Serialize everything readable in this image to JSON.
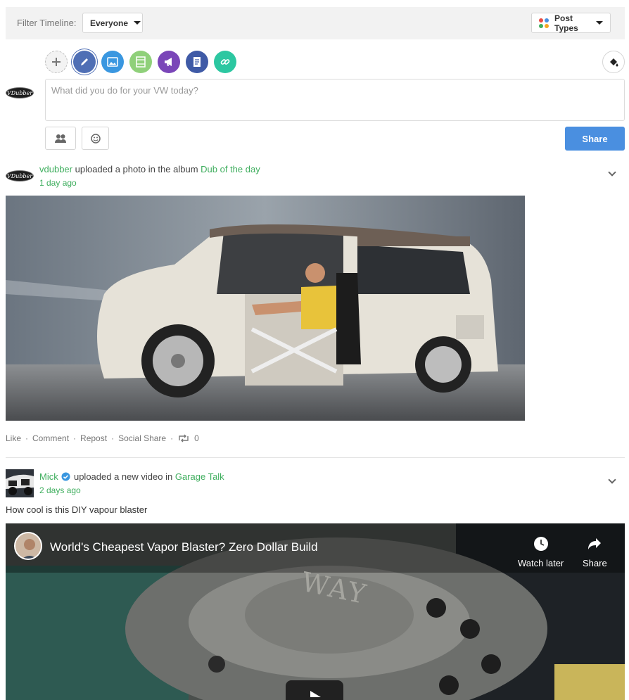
{
  "filter": {
    "label": "Filter Timeline:",
    "audience": "Everyone",
    "post_types_label": "Post Types",
    "dot_colors": [
      "#e84b43",
      "#4a8fe0",
      "#3fae5e",
      "#f5a623"
    ]
  },
  "composer": {
    "type_icons": [
      "plus-icon",
      "pencil-icon",
      "photo-icon",
      "film-icon",
      "megaphone-icon",
      "document-icon",
      "link-icon"
    ],
    "placeholder": "What did you do for your VW today?",
    "avatar_text": "VDubber",
    "share_label": "Share",
    "accent_color": "#4a8fe0"
  },
  "post1": {
    "author": "vdubber",
    "action": "uploaded a photo in the album",
    "album": "Dub of the day",
    "time": "1 day ago",
    "actions": {
      "like": "Like",
      "comment": "Comment",
      "repost": "Repost",
      "social_share": "Social Share",
      "repost_count": "0"
    }
  },
  "post2": {
    "author": "Mick",
    "action": "uploaded a new video in",
    "group": "Garage Talk",
    "time": "2 days ago",
    "caption": "How cool is this DIY vapour blaster",
    "video": {
      "title": "World's Cheapest Vapor Blaster? Zero Dollar Build",
      "watch_later": "Watch later",
      "share": "Share",
      "stamp_text": "WAY"
    }
  }
}
